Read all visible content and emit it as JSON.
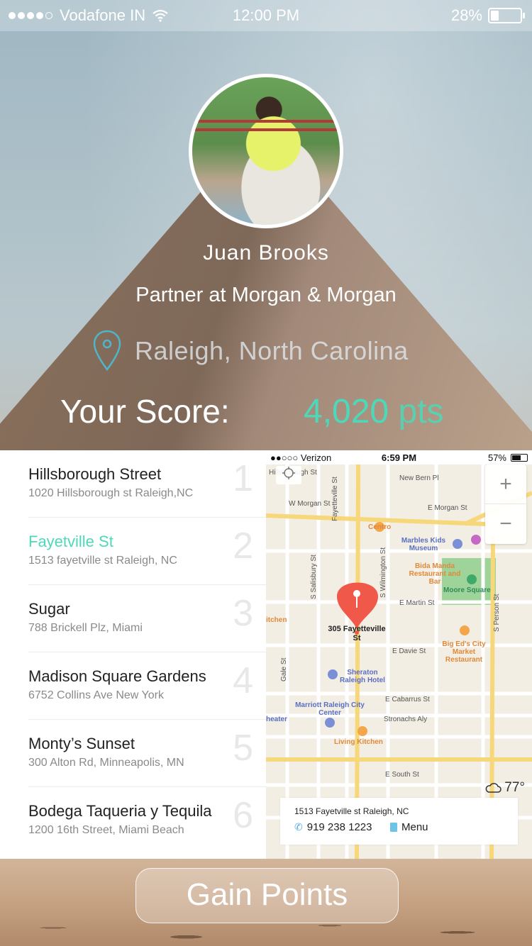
{
  "status_bar": {
    "carrier": "Vodafone IN",
    "time": "12:00 PM",
    "battery": "28%"
  },
  "profile": {
    "name": "Juan Brooks",
    "title": "Partner at Morgan & Morgan",
    "location": "Raleigh, North Carolina"
  },
  "score": {
    "label": "Your Score:",
    "value": "4,020",
    "unit": "pts"
  },
  "places": [
    {
      "name": "Hillsborough Street",
      "address": "1020 Hillsborough st Raleigh,NC",
      "rank": "1"
    },
    {
      "name": "Fayetville St",
      "address": "1513 fayetville st Raleigh, NC",
      "rank": "2"
    },
    {
      "name": "Sugar",
      "address": "788 Brickell Plz, Miami",
      "rank": "3"
    },
    {
      "name": "Madison Square Gardens",
      "address": "6752 Collins Ave New York",
      "rank": "4"
    },
    {
      "name": "Monty’s Sunset",
      "address": "300 Alton Rd, Minneapolis, MN",
      "rank": "5"
    },
    {
      "name": "Bodega Taqueria y Tequila",
      "address": "1200 16th Street, Miami Beach",
      "rank": "6"
    }
  ],
  "map": {
    "status": {
      "carrier": "Verizon",
      "time": "6:59 PM",
      "battery": "57%"
    },
    "roads": {
      "hillsborough": "Hillsborough St",
      "morgan_w": "W Morgan St",
      "morgan_e": "E Morgan St",
      "new_bern": "New Bern Pl",
      "fayetteville": "Fayetteville St",
      "salisbury": "S Salisbury St",
      "wilmington": "S Wilmington St",
      "martin": "E Martin St",
      "davie": "E Davie St",
      "gale": "Gale St",
      "cabarrus": "E Cabarrus St",
      "stronachs": "Stronachs Aly",
      "south": "E South St",
      "person": "S Person St"
    },
    "pois": {
      "centro": "Centro",
      "marbles": "Marbles Kids Museum",
      "bida": "Bida Manda Restaurant and Bar",
      "moore": "Moore Square",
      "kitchen": "itchen",
      "bigeds": "Big Ed's City Market Restaurant",
      "sheraton": "Sheraton Raleigh Hotel",
      "marriott": "Marriott Raleigh City Center",
      "theater": "heater",
      "living": "Living Kitchen"
    },
    "pin_label": "305 Fayetteville St",
    "temperature": "77°",
    "card": {
      "address": "1513 Fayetville st Raleigh, NC",
      "phone": "919 238 1223",
      "menu": "Menu"
    },
    "colors": {
      "pin": "#f0594a",
      "park": "#9ed49a",
      "road_major": "#f6d77a",
      "road_minor": "#ffffff"
    }
  },
  "gain_points": "Gain Points",
  "accent_color": "#4dd9b9"
}
